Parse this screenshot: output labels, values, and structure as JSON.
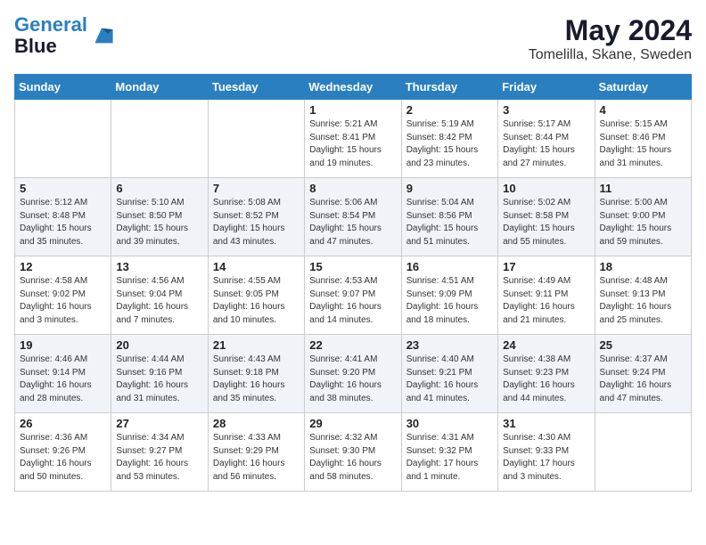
{
  "header": {
    "logo_line1": "General",
    "logo_line2": "Blue",
    "month": "May 2024",
    "location": "Tomelilla, Skane, Sweden"
  },
  "weekdays": [
    "Sunday",
    "Monday",
    "Tuesday",
    "Wednesday",
    "Thursday",
    "Friday",
    "Saturday"
  ],
  "weeks": [
    [
      {
        "day": "",
        "info": ""
      },
      {
        "day": "",
        "info": ""
      },
      {
        "day": "",
        "info": ""
      },
      {
        "day": "1",
        "info": "Sunrise: 5:21 AM\nSunset: 8:41 PM\nDaylight: 15 hours\nand 19 minutes."
      },
      {
        "day": "2",
        "info": "Sunrise: 5:19 AM\nSunset: 8:42 PM\nDaylight: 15 hours\nand 23 minutes."
      },
      {
        "day": "3",
        "info": "Sunrise: 5:17 AM\nSunset: 8:44 PM\nDaylight: 15 hours\nand 27 minutes."
      },
      {
        "day": "4",
        "info": "Sunrise: 5:15 AM\nSunset: 8:46 PM\nDaylight: 15 hours\nand 31 minutes."
      }
    ],
    [
      {
        "day": "5",
        "info": "Sunrise: 5:12 AM\nSunset: 8:48 PM\nDaylight: 15 hours\nand 35 minutes."
      },
      {
        "day": "6",
        "info": "Sunrise: 5:10 AM\nSunset: 8:50 PM\nDaylight: 15 hours\nand 39 minutes."
      },
      {
        "day": "7",
        "info": "Sunrise: 5:08 AM\nSunset: 8:52 PM\nDaylight: 15 hours\nand 43 minutes."
      },
      {
        "day": "8",
        "info": "Sunrise: 5:06 AM\nSunset: 8:54 PM\nDaylight: 15 hours\nand 47 minutes."
      },
      {
        "day": "9",
        "info": "Sunrise: 5:04 AM\nSunset: 8:56 PM\nDaylight: 15 hours\nand 51 minutes."
      },
      {
        "day": "10",
        "info": "Sunrise: 5:02 AM\nSunset: 8:58 PM\nDaylight: 15 hours\nand 55 minutes."
      },
      {
        "day": "11",
        "info": "Sunrise: 5:00 AM\nSunset: 9:00 PM\nDaylight: 15 hours\nand 59 minutes."
      }
    ],
    [
      {
        "day": "12",
        "info": "Sunrise: 4:58 AM\nSunset: 9:02 PM\nDaylight: 16 hours\nand 3 minutes."
      },
      {
        "day": "13",
        "info": "Sunrise: 4:56 AM\nSunset: 9:04 PM\nDaylight: 16 hours\nand 7 minutes."
      },
      {
        "day": "14",
        "info": "Sunrise: 4:55 AM\nSunset: 9:05 PM\nDaylight: 16 hours\nand 10 minutes."
      },
      {
        "day": "15",
        "info": "Sunrise: 4:53 AM\nSunset: 9:07 PM\nDaylight: 16 hours\nand 14 minutes."
      },
      {
        "day": "16",
        "info": "Sunrise: 4:51 AM\nSunset: 9:09 PM\nDaylight: 16 hours\nand 18 minutes."
      },
      {
        "day": "17",
        "info": "Sunrise: 4:49 AM\nSunset: 9:11 PM\nDaylight: 16 hours\nand 21 minutes."
      },
      {
        "day": "18",
        "info": "Sunrise: 4:48 AM\nSunset: 9:13 PM\nDaylight: 16 hours\nand 25 minutes."
      }
    ],
    [
      {
        "day": "19",
        "info": "Sunrise: 4:46 AM\nSunset: 9:14 PM\nDaylight: 16 hours\nand 28 minutes."
      },
      {
        "day": "20",
        "info": "Sunrise: 4:44 AM\nSunset: 9:16 PM\nDaylight: 16 hours\nand 31 minutes."
      },
      {
        "day": "21",
        "info": "Sunrise: 4:43 AM\nSunset: 9:18 PM\nDaylight: 16 hours\nand 35 minutes."
      },
      {
        "day": "22",
        "info": "Sunrise: 4:41 AM\nSunset: 9:20 PM\nDaylight: 16 hours\nand 38 minutes."
      },
      {
        "day": "23",
        "info": "Sunrise: 4:40 AM\nSunset: 9:21 PM\nDaylight: 16 hours\nand 41 minutes."
      },
      {
        "day": "24",
        "info": "Sunrise: 4:38 AM\nSunset: 9:23 PM\nDaylight: 16 hours\nand 44 minutes."
      },
      {
        "day": "25",
        "info": "Sunrise: 4:37 AM\nSunset: 9:24 PM\nDaylight: 16 hours\nand 47 minutes."
      }
    ],
    [
      {
        "day": "26",
        "info": "Sunrise: 4:36 AM\nSunset: 9:26 PM\nDaylight: 16 hours\nand 50 minutes."
      },
      {
        "day": "27",
        "info": "Sunrise: 4:34 AM\nSunset: 9:27 PM\nDaylight: 16 hours\nand 53 minutes."
      },
      {
        "day": "28",
        "info": "Sunrise: 4:33 AM\nSunset: 9:29 PM\nDaylight: 16 hours\nand 56 minutes."
      },
      {
        "day": "29",
        "info": "Sunrise: 4:32 AM\nSunset: 9:30 PM\nDaylight: 16 hours\nand 58 minutes."
      },
      {
        "day": "30",
        "info": "Sunrise: 4:31 AM\nSunset: 9:32 PM\nDaylight: 17 hours\nand 1 minute."
      },
      {
        "day": "31",
        "info": "Sunrise: 4:30 AM\nSunset: 9:33 PM\nDaylight: 17 hours\nand 3 minutes."
      },
      {
        "day": "",
        "info": ""
      }
    ]
  ]
}
